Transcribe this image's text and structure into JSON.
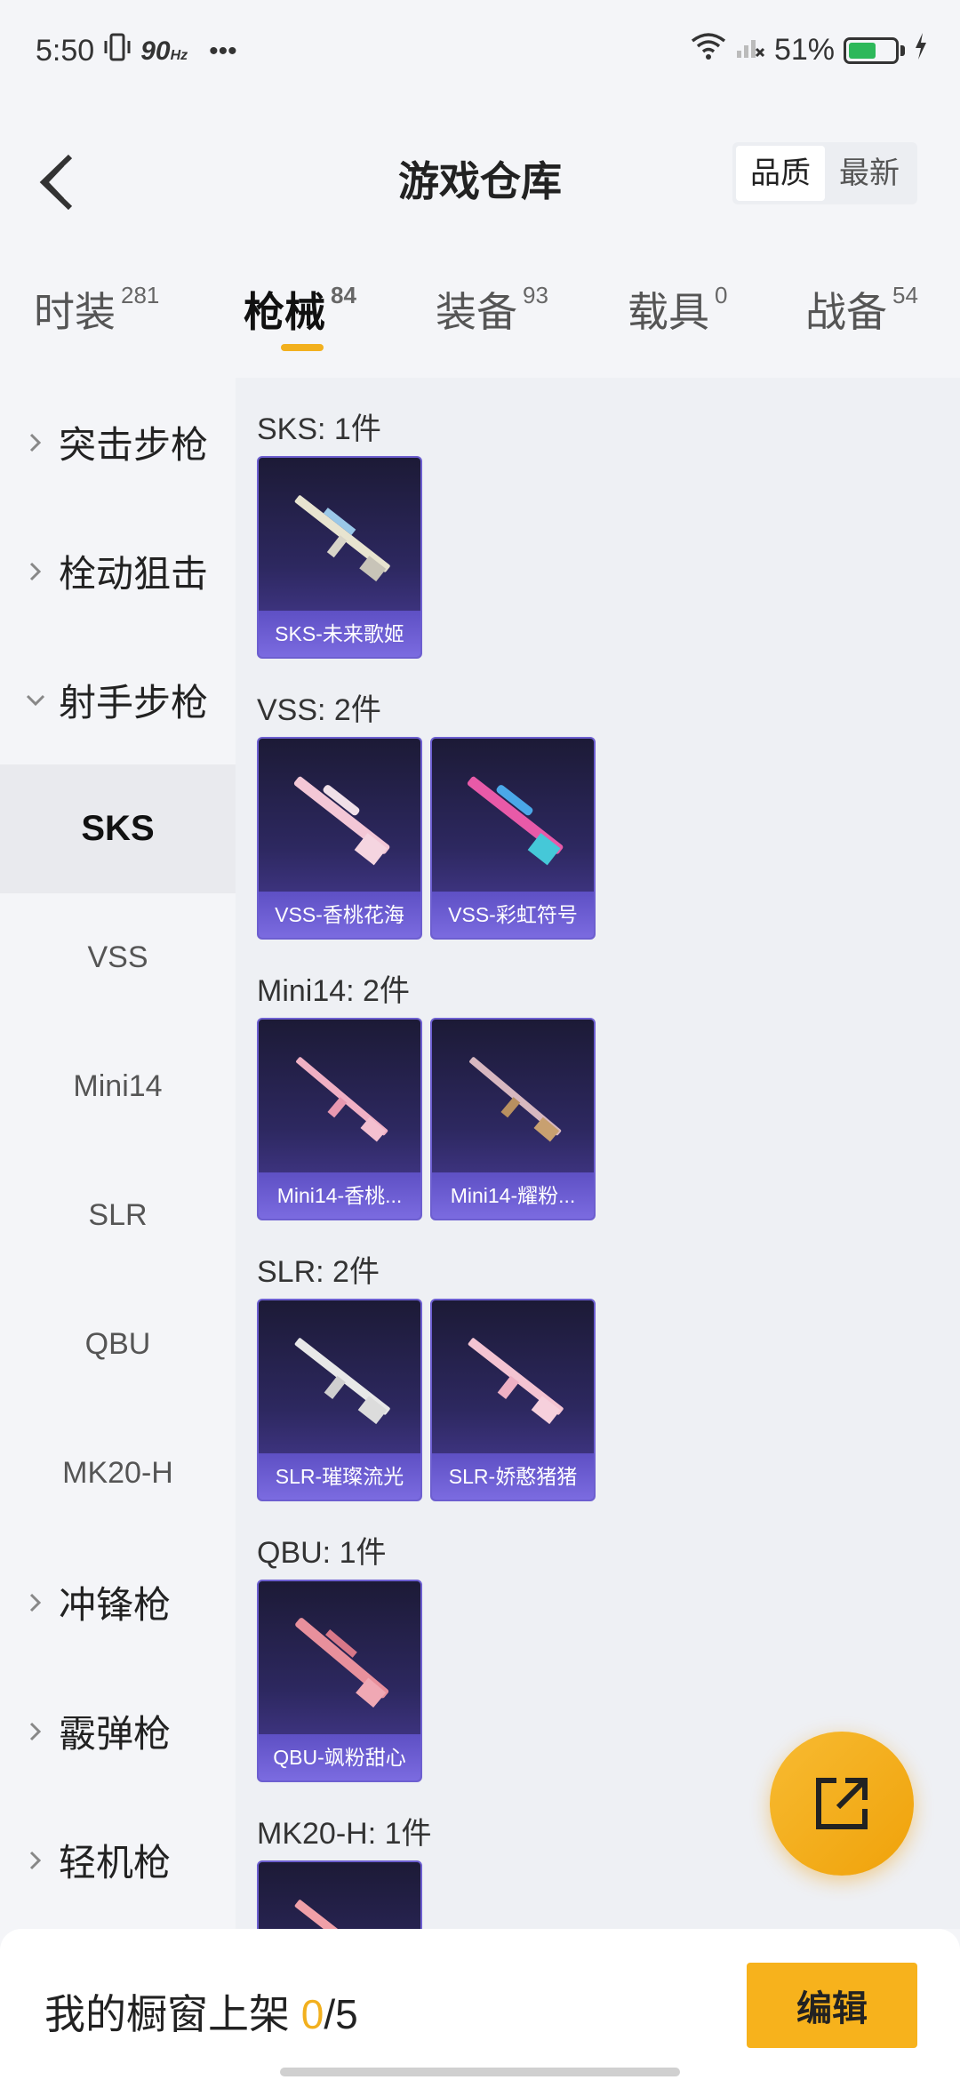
{
  "status_bar": {
    "time": "5:50",
    "refresh_rate": "90",
    "refresh_unit": "Hz",
    "more": "•••",
    "battery": "51%"
  },
  "header": {
    "title": "游戏仓库",
    "sort_options": [
      "品质",
      "最新"
    ],
    "sort_selected": "品质"
  },
  "tabs": [
    {
      "label": "时装",
      "count": "281"
    },
    {
      "label": "枪械",
      "count": "84"
    },
    {
      "label": "装备",
      "count": "93"
    },
    {
      "label": "载具",
      "count": "0"
    },
    {
      "label": "战备",
      "count": "54"
    }
  ],
  "active_tab": "枪械",
  "sidebar": {
    "categories_top": [
      "突击步枪",
      "栓动狙击",
      "射手步枪"
    ],
    "subitems": [
      "SKS",
      "VSS",
      "Mini14",
      "SLR",
      "QBU",
      "MK20-H"
    ],
    "active_sub": "SKS",
    "categories_bottom": [
      "冲锋枪",
      "霰弹枪",
      "轻机枪"
    ]
  },
  "groups": [
    {
      "title": "SKS: 1件",
      "items": [
        "SKS-未来歌姬"
      ]
    },
    {
      "title": "VSS: 2件",
      "items": [
        "VSS-香桃花海",
        "VSS-彩虹符号"
      ]
    },
    {
      "title": "Mini14: 2件",
      "items": [
        "Mini14-香桃...",
        "Mini14-耀粉..."
      ]
    },
    {
      "title": "SLR: 2件",
      "items": [
        "SLR-璀璨流光",
        "SLR-娇憨猪猪"
      ]
    },
    {
      "title": "QBU: 1件",
      "items": [
        "QBU-飒粉甜心"
      ]
    },
    {
      "title": "MK20-H: 1件",
      "items": []
    }
  ],
  "bottom_bar": {
    "shelf_label": "我的橱窗上架",
    "shelf_current": "0",
    "shelf_total": "/5",
    "edit_label": "编辑"
  },
  "colors": {
    "accent": "#f2b01e",
    "card_bg": "#2d2860",
    "card_label": "#6b5bd6"
  }
}
